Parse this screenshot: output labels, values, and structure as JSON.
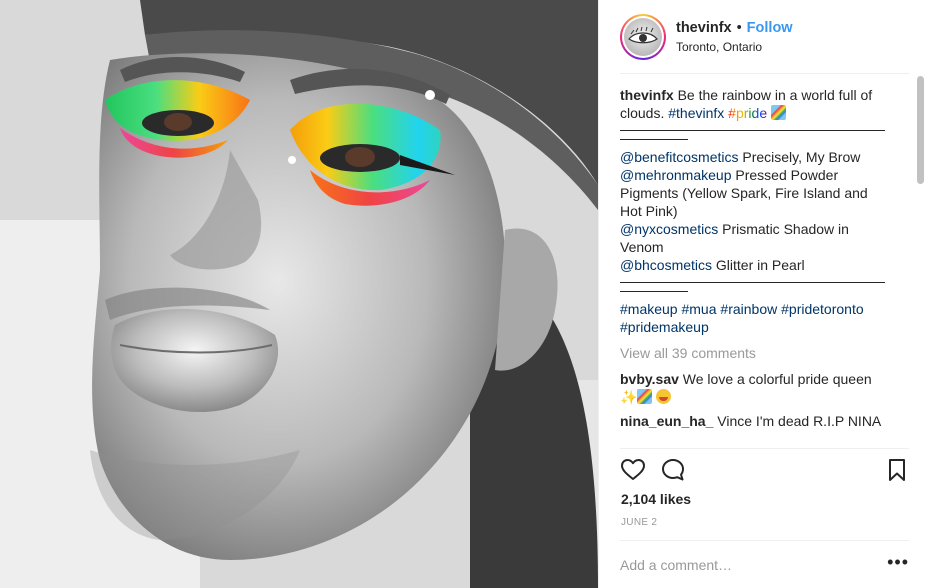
{
  "post": {
    "username": "thevinfx",
    "separator": "•",
    "follow_label": "Follow",
    "location": "Toronto, Ontario",
    "photo_icon": "post-photo"
  },
  "caption": {
    "username": "thevinfx",
    "text": "Be the rainbow in a world full of clouds.",
    "hashtag_1": "#thevinfx",
    "hashtag_2": "#pride",
    "emoji": "rainbow-emoji",
    "products": [
      {
        "handle": "@benefitcosmetics",
        "text": "Precisely, My Brow"
      },
      {
        "handle": "@mehronmakeup",
        "text": "Pressed Powder Pigments (Yellow Spark, Fire Island and Hot Pink)"
      },
      {
        "handle": "@nyxcosmetics",
        "text": "Prismatic Shadow in Venom"
      },
      {
        "handle": "@bhcosmetics",
        "text": "Glitter in Pearl"
      }
    ],
    "tags": [
      "#makeup",
      "#mua",
      "#rainbow",
      "#pridetoronto",
      "#pridemakeup"
    ]
  },
  "view_all": "View all 39 comments",
  "comments": [
    {
      "username": "bvby.sav",
      "text": "We love a colorful pride queen",
      "emojis": [
        "sparkles-emoji",
        "rainbow-emoji",
        "heart-eyes-emoji"
      ]
    },
    {
      "username": "nina_eun_ha_",
      "text": "Vince I'm dead R.I.P NINA"
    }
  ],
  "actions": {
    "like_icon": "heart-icon",
    "comment_icon": "comment-bubble-icon",
    "save_icon": "bookmark-icon"
  },
  "likes": "2,104 likes",
  "date": "JUNE 2",
  "add_comment_placeholder": "Add a comment…",
  "more_options": "•••",
  "colors": {
    "link_blue": "#3897f0",
    "hashtag_blue": "#003569",
    "text": "#262626",
    "muted": "#999999",
    "divider": "#efefef"
  }
}
